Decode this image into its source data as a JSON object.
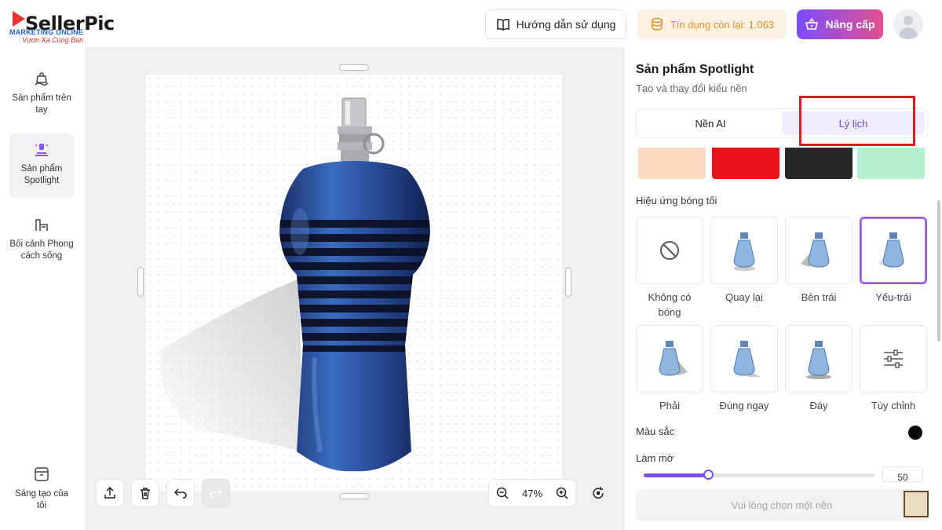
{
  "header": {
    "logo_text": "SellerPic",
    "watermark_line1": "MARKETING ONLINE",
    "watermark_line2": "Vươn Xa Cùng Bạn",
    "guide_label": "Hướng dẫn sử dụng",
    "credit_label": "Tín dụng còn lại: 1.063",
    "upgrade_label": "Nâng cấp"
  },
  "sidebar": {
    "items": [
      {
        "label": "Sản phẩm trên tay",
        "icon": "hand-bag-icon"
      },
      {
        "label": "Sản phẩm Spotlight",
        "icon": "spotlight-icon",
        "active": true
      },
      {
        "label": "Bối cảnh Phong cách sống",
        "icon": "lifestyle-icon"
      },
      {
        "label": "Sáng tạo của tôi",
        "icon": "my-creations-icon"
      }
    ]
  },
  "canvas": {
    "zoom": "47%"
  },
  "panel": {
    "title": "Sản phẩm Spotlight",
    "subtitle": "Tạo và thay đổi kiểu nền",
    "tabs": [
      {
        "label": "Nền AI",
        "active": false
      },
      {
        "label": "Lý lịch",
        "active": true
      }
    ],
    "swatches": [
      "#fcd9c2",
      "#e8141b",
      "#262626",
      "#b3f0cf"
    ],
    "shadow_section": "Hiệu ứng bóng tối",
    "shadow_options": [
      {
        "label": "Không có bóng",
        "icon": "no-shadow-icon"
      },
      {
        "label": "Quay lại",
        "icon": "bottle-icon"
      },
      {
        "label": "Bên trái",
        "icon": "bottle-icon"
      },
      {
        "label": "Yếu-trái",
        "icon": "bottle-icon",
        "selected": true
      },
      {
        "label": "Phải",
        "icon": "bottle-icon"
      },
      {
        "label": "Đúng ngay",
        "icon": "bottle-icon"
      },
      {
        "label": "Đáy",
        "icon": "bottle-icon"
      },
      {
        "label": "Tùy chỉnh",
        "icon": "sliders-icon"
      }
    ],
    "color_label": "Màu sắc",
    "shadow_color": "#0a0a0a",
    "blur_label": "Làm mờ",
    "blur_value": "50",
    "blur_fraction": 0.28,
    "bottom_prompt": "Vui lòng chọn một nền"
  },
  "colors": {
    "accent": "#7a4df0",
    "highlight": "#e01b24"
  }
}
